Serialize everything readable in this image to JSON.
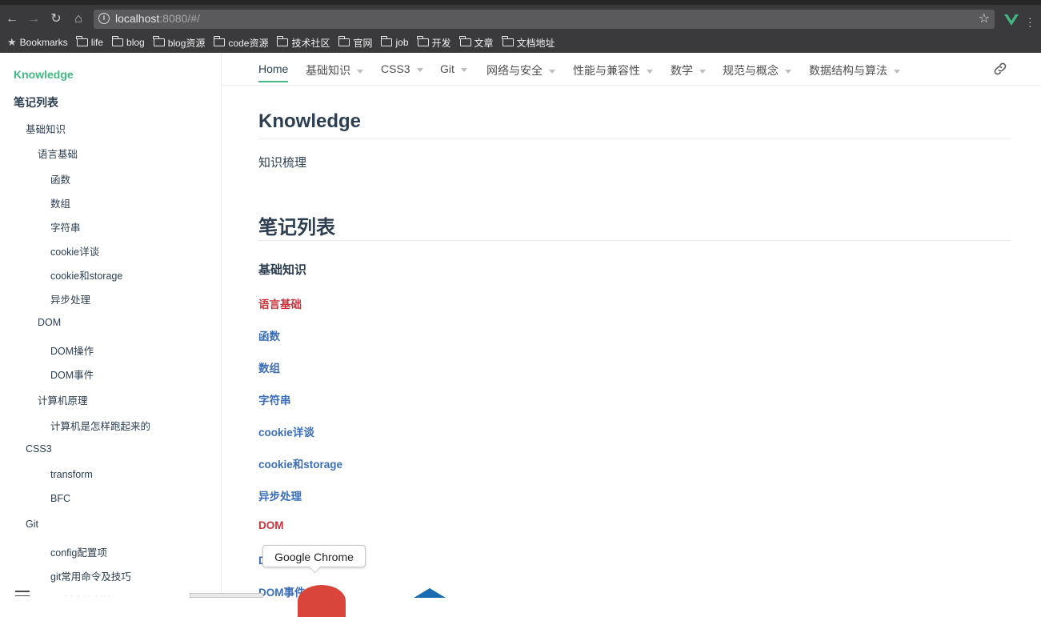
{
  "browser": {
    "url_host": "localhost",
    "url_rest": ":8080/#/",
    "bookmarks": [
      {
        "label": "Bookmarks",
        "type": "star"
      },
      {
        "label": "life",
        "type": "folder"
      },
      {
        "label": "blog",
        "type": "folder"
      },
      {
        "label": "blog资源",
        "type": "folder"
      },
      {
        "label": "code资源",
        "type": "folder"
      },
      {
        "label": "技术社区",
        "type": "folder"
      },
      {
        "label": "官网",
        "type": "folder"
      },
      {
        "label": "job",
        "type": "folder"
      },
      {
        "label": "开发",
        "type": "folder"
      },
      {
        "label": "文章",
        "type": "folder"
      },
      {
        "label": "文档地址",
        "type": "folder"
      }
    ]
  },
  "sidebar": {
    "title": "Knowledge",
    "items": [
      {
        "label": "笔记列表",
        "level": 0
      },
      {
        "label": "基础知识",
        "level": 1
      },
      {
        "label": "语言基础",
        "level": 2
      },
      {
        "label": "函数",
        "level": 3
      },
      {
        "label": "数组",
        "level": 3
      },
      {
        "label": "字符串",
        "level": 3
      },
      {
        "label": "cookie详谈",
        "level": 3
      },
      {
        "label": "cookie和storage",
        "level": 3
      },
      {
        "label": "异步处理",
        "level": 3
      },
      {
        "label": "DOM",
        "level": 2
      },
      {
        "label": "DOM操作",
        "level": 3
      },
      {
        "label": "DOM事件",
        "level": 3
      },
      {
        "label": "计算机原理",
        "level": 2
      },
      {
        "label": "计算机是怎样跑起来的",
        "level": 3
      },
      {
        "label": "CSS3",
        "level": 1
      },
      {
        "label": "transform",
        "level": 3
      },
      {
        "label": "BFC",
        "level": 3
      },
      {
        "label": "Git",
        "level": 1
      },
      {
        "label": "config配置项",
        "level": 3
      },
      {
        "label": "git常用命令及技巧",
        "level": 3
      },
      {
        "label": "Git版本控制管理",
        "level": 3
      }
    ]
  },
  "nav": {
    "items": [
      {
        "label": "Home",
        "dropdown": false,
        "active": true
      },
      {
        "label": "基础知识",
        "dropdown": true
      },
      {
        "label": "CSS3",
        "dropdown": true
      },
      {
        "label": "Git",
        "dropdown": true
      },
      {
        "label": "网络与安全",
        "dropdown": true
      },
      {
        "label": "性能与兼容性",
        "dropdown": true
      },
      {
        "label": "数学",
        "dropdown": true
      },
      {
        "label": "规范与概念",
        "dropdown": true
      },
      {
        "label": "数据结构与算法",
        "dropdown": true
      }
    ]
  },
  "content": {
    "title": "Knowledge",
    "intro": "知识梳理",
    "notes_heading": "笔记列表",
    "section_heading": "基础知识",
    "links": [
      {
        "label": "语言基础",
        "color": "#c7353d"
      },
      {
        "label": "函数",
        "color": "#3a6eb8"
      },
      {
        "label": "数组",
        "color": "#3a6eb8"
      },
      {
        "label": "字符串",
        "color": "#3a6eb8"
      },
      {
        "label": "cookie详谈",
        "color": "#3a6eb8"
      },
      {
        "label": "cookie和storage",
        "color": "#3a6eb8"
      },
      {
        "label": "异步处理",
        "color": "#3a6eb8"
      },
      {
        "label": "DOM",
        "color": "#c7353d"
      },
      {
        "label": "DOM操作",
        "color": "#3a6eb8"
      },
      {
        "label": "DOM事件",
        "color": "#3a6eb8"
      }
    ]
  },
  "tooltip": {
    "text": "Google Chrome"
  },
  "colors": {
    "accent": "#42b983",
    "link_blue": "#3a6eb8",
    "link_red": "#c7353d",
    "text": "#2c3e50"
  }
}
